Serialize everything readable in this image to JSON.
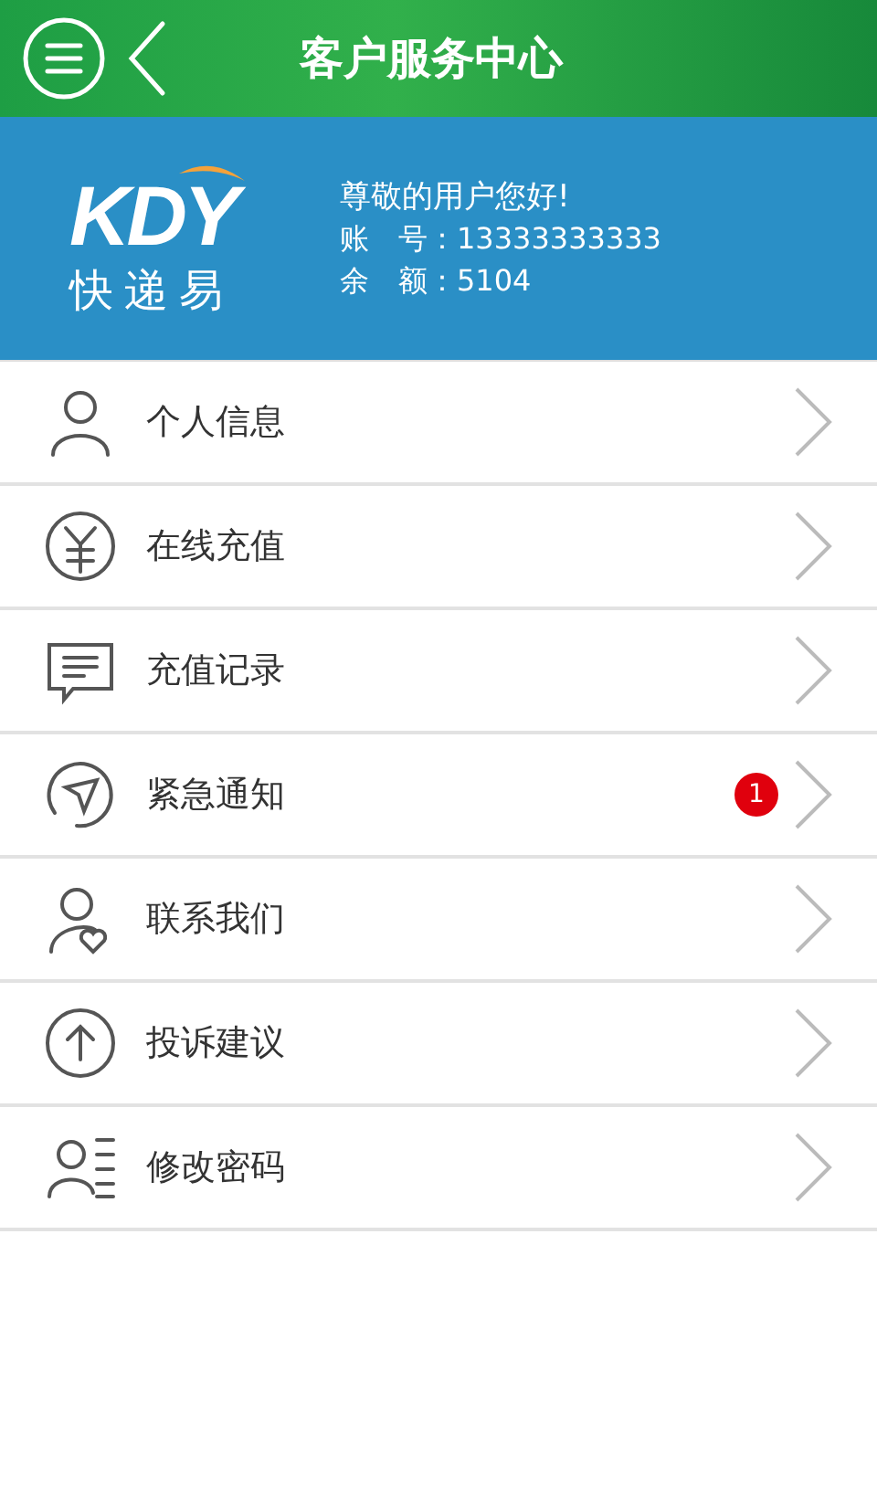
{
  "header": {
    "title": "客户服务中心"
  },
  "profile": {
    "logo": {
      "mark": "KDY",
      "name": "快递易"
    },
    "greeting": "尊敬的用户您好!",
    "fields": [
      {
        "label": "账　号：",
        "value": "13333333333"
      },
      {
        "label": "余　额：",
        "value": "5104"
      }
    ]
  },
  "menu": [
    {
      "kind": "person",
      "label": "个人信息"
    },
    {
      "kind": "yuan",
      "label": "在线充值"
    },
    {
      "kind": "message",
      "label": "充值记录"
    },
    {
      "kind": "notice",
      "label": "紧急通知",
      "badge": "1"
    },
    {
      "kind": "contact",
      "label": "联系我们"
    },
    {
      "kind": "upload",
      "label": "投诉建议"
    },
    {
      "kind": "password",
      "label": "修改密码"
    }
  ]
}
